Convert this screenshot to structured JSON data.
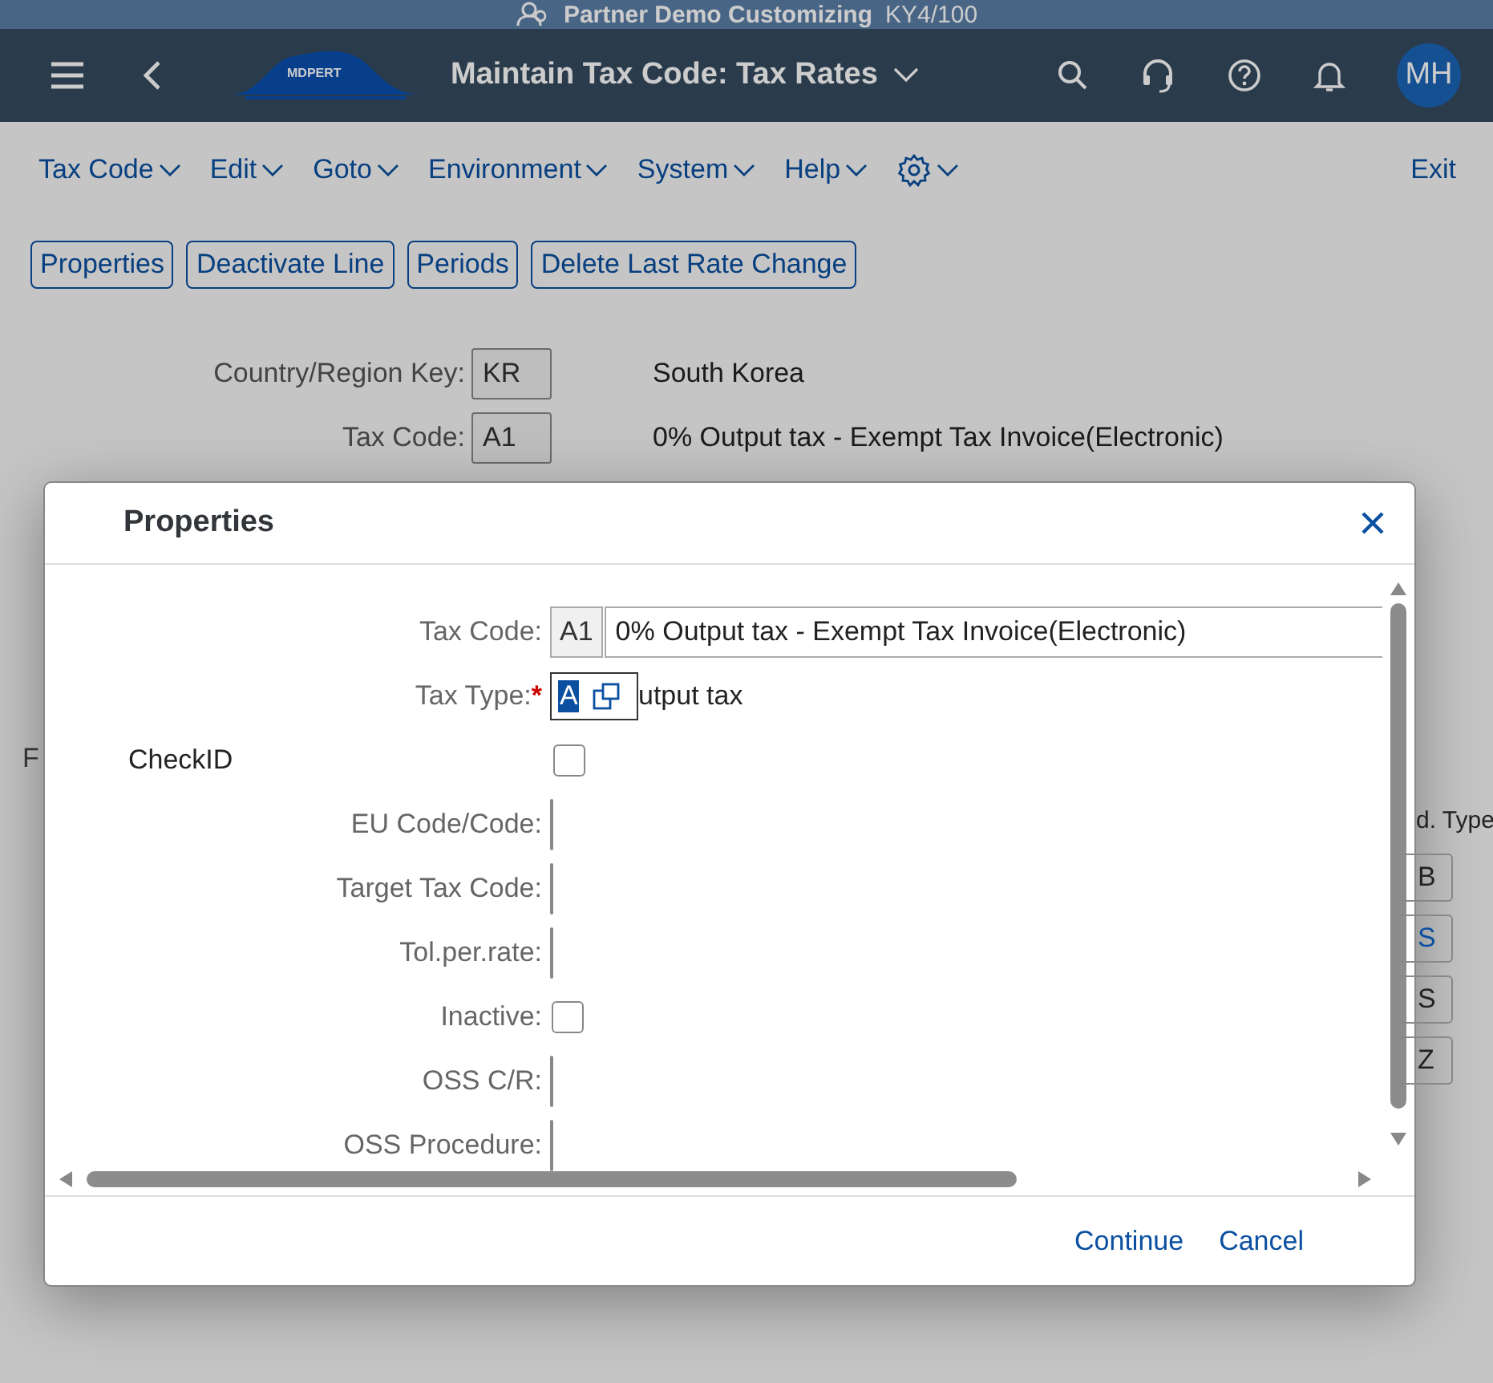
{
  "system_bar": {
    "title": "Partner Demo Customizing",
    "client": "KY4/100"
  },
  "shell": {
    "logo_text": "MDPERT",
    "title": "Maintain Tax Code: Tax Rates",
    "avatar": "MH"
  },
  "menu": [
    "Tax Code",
    "Edit",
    "Goto",
    "Environment",
    "System",
    "Help"
  ],
  "exit": "Exit",
  "toolbar": [
    "Properties",
    "Deactivate Line",
    "Periods",
    "Delete Last Rate Change"
  ],
  "header_fields": [
    {
      "label": "Country/Region Key:",
      "value": "KR",
      "description": "South Korea"
    },
    {
      "label": "Tax Code:",
      "value": "A1",
      "description": "0% Output tax - Exempt Tax Invoice(Electronic)"
    }
  ],
  "background_table": {
    "section_fragment": "F",
    "column_heading": "d. Type",
    "cells": [
      {
        "text": "B",
        "highlighted": false
      },
      {
        "text": "S",
        "highlighted": true
      },
      {
        "text": "S",
        "highlighted": false
      },
      {
        "text": "Z",
        "highlighted": false
      }
    ]
  },
  "dialog": {
    "title": "Properties",
    "rows": [
      {
        "kind": "code",
        "label": "Tax Code:",
        "value": "A1",
        "description": "0% Output tax - Exempt Tax Invoice(Electronic)"
      },
      {
        "kind": "valuehelp",
        "label": "Tax Type:",
        "required_mark": "*",
        "value": "A",
        "description": "utput tax"
      },
      {
        "kind": "checkleft",
        "label": "CheckID",
        "checked": false
      },
      {
        "kind": "tinyinput",
        "label": "EU Code/Code:"
      },
      {
        "kind": "shortinput",
        "label": "Target Tax Code:"
      },
      {
        "kind": "wideinput",
        "label": "Tol.per.rate:"
      },
      {
        "kind": "check",
        "label": "Inactive:",
        "checked": false
      },
      {
        "kind": "mediuminput",
        "label": "OSS C/R:"
      },
      {
        "kind": "tinyinput",
        "label": "OSS Procedure:"
      }
    ],
    "buttons": [
      "Continue",
      "Cancel"
    ]
  }
}
